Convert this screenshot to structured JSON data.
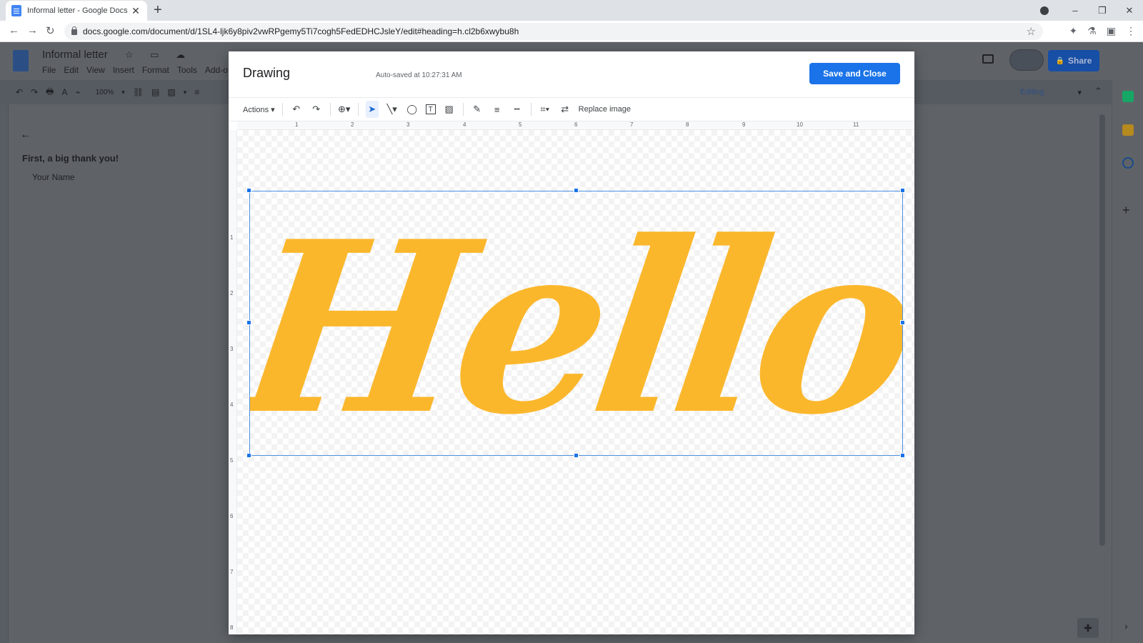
{
  "browser": {
    "tab_title": "Informal letter - Google Docs",
    "tab_close": "✕",
    "new_tab": "+",
    "url": "docs.google.com/document/d/1SL4-ljk6y8piv2vwRPgemy5Ti7cogh5FedEDHCJsleY/edit#heading=h.cl2b6xwybu8h",
    "window_controls": {
      "minimize": "–",
      "restore": "❐",
      "close": "✕"
    },
    "nav": {
      "back": "←",
      "forward": "→",
      "reload": "↻",
      "star": "☆"
    },
    "ext_icons": [
      "✦",
      "⚗",
      "▣",
      "⋮"
    ]
  },
  "docs": {
    "doc_title": "Informal letter",
    "title_icons": "☆ ▭ ☁",
    "menu": [
      "File",
      "Edit",
      "View",
      "Insert",
      "Format",
      "Tools",
      "Add-o"
    ],
    "share_label": "Share",
    "share_lock": "🔒",
    "zoom": "100%",
    "toolbar_icons": [
      "↶",
      "↷",
      "🖶",
      "A",
      "⌁",
      "100%",
      "▾",
      "⛓",
      "▤",
      "▨",
      "▾",
      "≡"
    ],
    "editing_label": "Editing",
    "editing_caret": "▾",
    "collapse": "⌃",
    "outline": {
      "back": "←",
      "heading_1": "First, a big thank you!",
      "heading_2": "Your Name"
    },
    "side_add": "+",
    "explore_icon": "✚",
    "side_arrow": "›"
  },
  "drawing": {
    "title": "Drawing",
    "autosave": "Auto-saved at 10:27:31 AM",
    "save_close_label": "Save and Close",
    "toolbar": {
      "actions": "Actions ▾",
      "undo": "↶",
      "redo": "↷",
      "zoom": "⊕▾",
      "select": "➤",
      "line": "╲▾",
      "shape": "◯",
      "textbox": "T",
      "image": "▨",
      "pen": "✎",
      "line_weight": "≡",
      "line_dash": "┅",
      "crop": "⌗▾",
      "replace_icon": "⇄",
      "replace_image": "Replace image"
    },
    "h_ruler_numbers": [
      "1",
      "2",
      "3",
      "4",
      "5",
      "6",
      "7",
      "8",
      "9",
      "10",
      "11"
    ],
    "v_ruler_numbers": [
      "1",
      "2",
      "3",
      "4",
      "5",
      "6",
      "7",
      "8"
    ],
    "image_text": "Hello",
    "image_color": "#fbb72c"
  }
}
